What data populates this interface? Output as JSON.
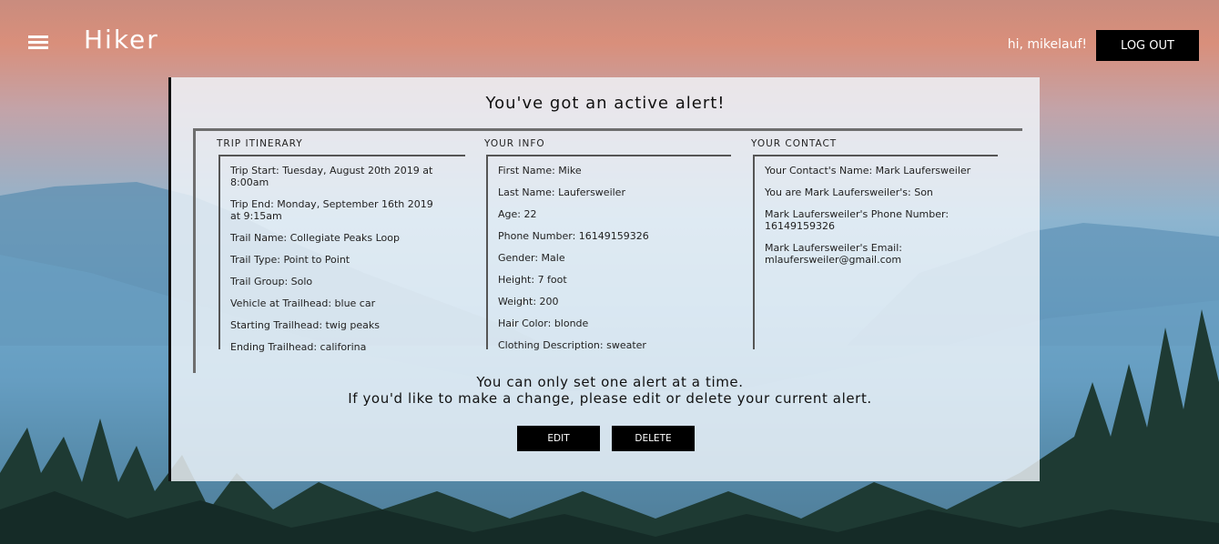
{
  "header": {
    "app_title": "Hiker",
    "greeting": "hi, mikelauf!",
    "logout_label": "LOG OUT"
  },
  "alert": {
    "title": "You've got an active alert!",
    "itinerary": {
      "heading": "TRIP ITINERARY",
      "items": [
        "Trip Start: Tuesday, August 20th 2019 at 8:00am",
        "Trip End: Monday, September 16th 2019 at 9:15am",
        "Trail Name: Collegiate Peaks Loop",
        "Trail Type: Point to Point",
        "Trail Group: Solo",
        "Vehicle at Trailhead: blue car",
        "Starting Trailhead: twig peaks",
        "Ending Trailhead: califorina"
      ]
    },
    "info": {
      "heading": "YOUR INFO",
      "items": [
        "First Name: Mike",
        "Last Name: Laufersweiler",
        "Age: 22",
        "Phone Number: 16149159326",
        "Gender: Male",
        "Height: 7 foot",
        "Weight: 200",
        "Hair Color: blonde",
        "Clothing Description: sweater"
      ]
    },
    "contact": {
      "heading": "YOUR CONTACT",
      "items": [
        "Your Contact's Name: Mark Laufersweiler",
        "You are Mark Laufersweiler's: Son",
        "Mark Laufersweiler's Phone Number: 16149159326",
        "Mark Laufersweiler's Email: mlaufersweiler@gmail.com"
      ]
    },
    "note_line1": "You can only set one alert at a time.",
    "note_line2": "If you'd like to make a change, please edit or delete your current alert.",
    "edit_label": "EDIT",
    "delete_label": "DELETE"
  }
}
